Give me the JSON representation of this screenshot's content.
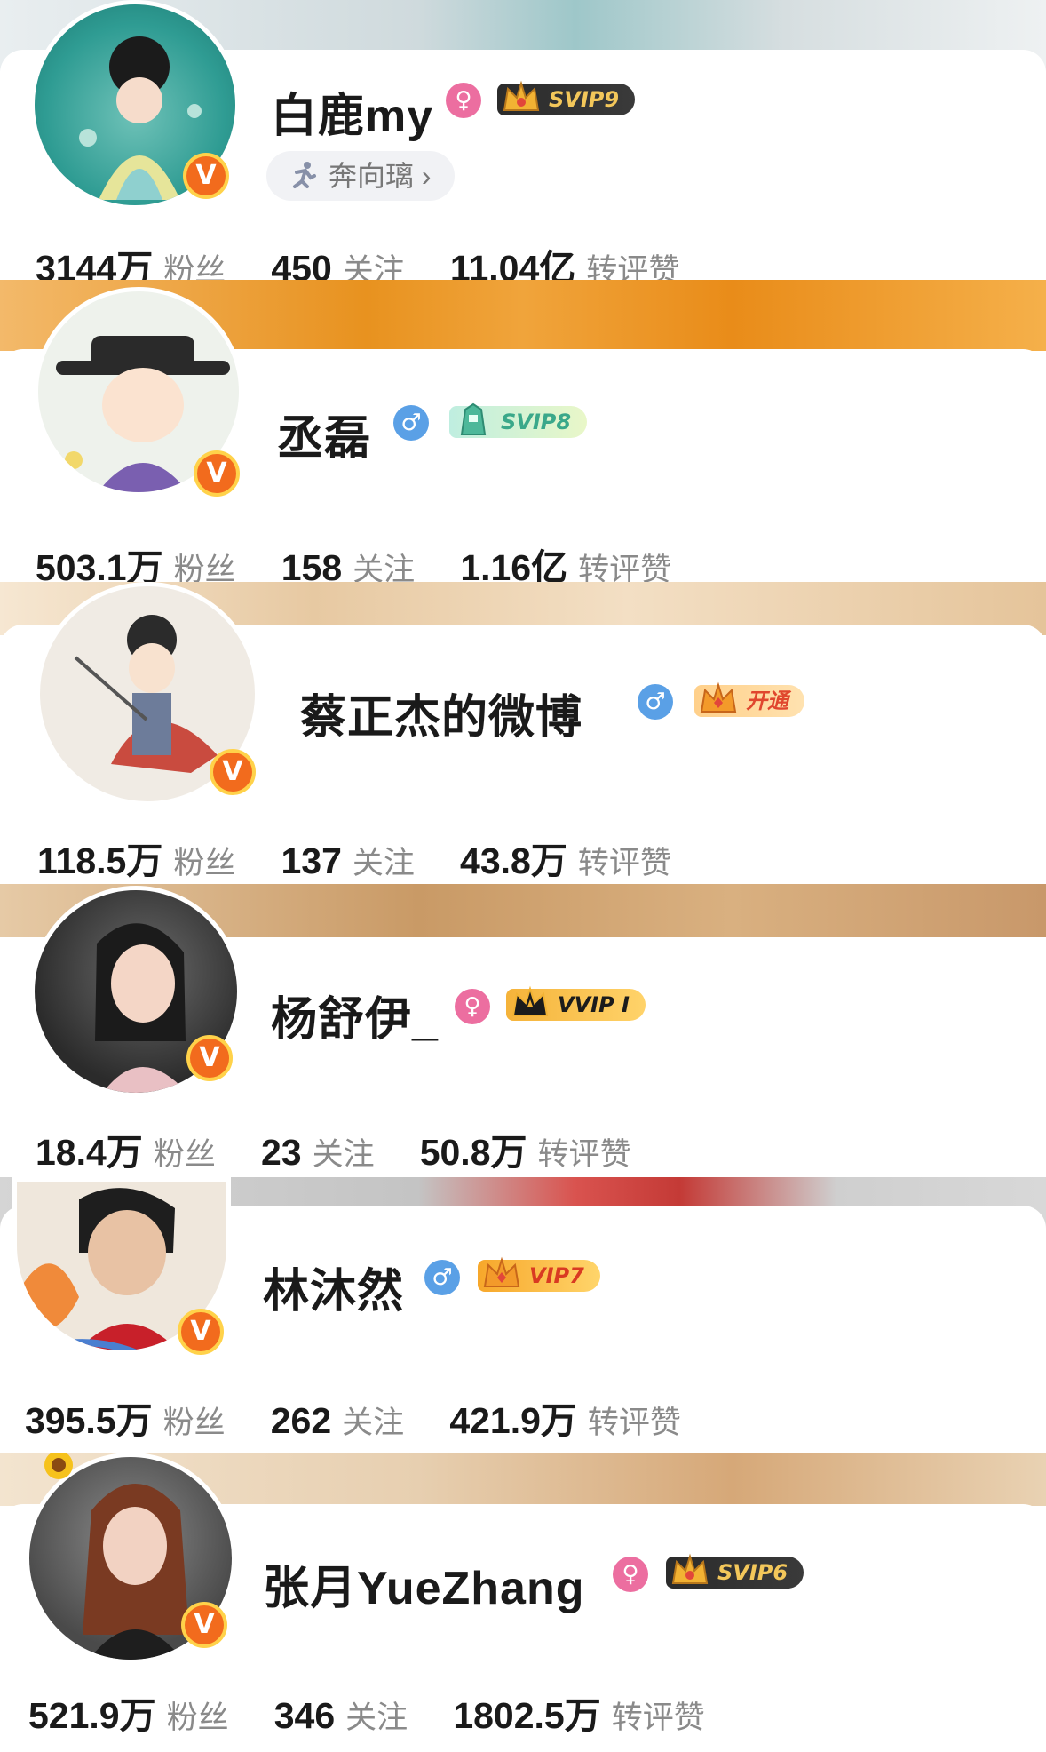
{
  "colors": {
    "female_badge": "#ec6ea0",
    "male_badge": "#5aa0e6",
    "verified_badge": "#f26b1d",
    "vip_gold": "#f2b233"
  },
  "profiles": [
    {
      "name": "白鹿my",
      "gender": "female",
      "gender_icon": "female-icon",
      "vip_label": "SVIP9",
      "chip_label": "奔向璃 ›",
      "stats": [
        {
          "num": "3144万",
          "label": "粉丝"
        },
        {
          "num": "450",
          "label": "关注"
        },
        {
          "num": "11.04亿",
          "label": "转评赞"
        }
      ]
    },
    {
      "name": "丞磊",
      "gender": "male",
      "gender_icon": "male-icon",
      "vip_label": "SVIP8",
      "stats": [
        {
          "num": "503.1万",
          "label": "粉丝"
        },
        {
          "num": "158",
          "label": "关注"
        },
        {
          "num": "1.16亿",
          "label": "转评赞"
        }
      ]
    },
    {
      "name": "蔡正杰的微博",
      "gender": "male",
      "gender_icon": "male-icon",
      "vip_label": "开通",
      "stats": [
        {
          "num": "118.5万",
          "label": "粉丝"
        },
        {
          "num": "137",
          "label": "关注"
        },
        {
          "num": "43.8万",
          "label": "转评赞"
        }
      ]
    },
    {
      "name": "杨舒伊_",
      "gender": "female",
      "gender_icon": "female-icon",
      "vip_label": "VVIP I",
      "stats": [
        {
          "num": "18.4万",
          "label": "粉丝"
        },
        {
          "num": "23",
          "label": "关注"
        },
        {
          "num": "50.8万",
          "label": "转评赞"
        }
      ]
    },
    {
      "name": "林沐然",
      "gender": "male",
      "gender_icon": "male-icon",
      "vip_label": "VIP7",
      "stats": [
        {
          "num": "395.5万",
          "label": "粉丝"
        },
        {
          "num": "262",
          "label": "关注"
        },
        {
          "num": "421.9万",
          "label": "转评赞"
        }
      ]
    },
    {
      "name": "张月YueZhang",
      "gender": "female",
      "gender_icon": "female-icon",
      "vip_label": "SVIP6",
      "stats": [
        {
          "num": "521.9万",
          "label": "粉丝"
        },
        {
          "num": "346",
          "label": "关注"
        },
        {
          "num": "1802.5万",
          "label": "转评赞"
        }
      ]
    }
  ]
}
